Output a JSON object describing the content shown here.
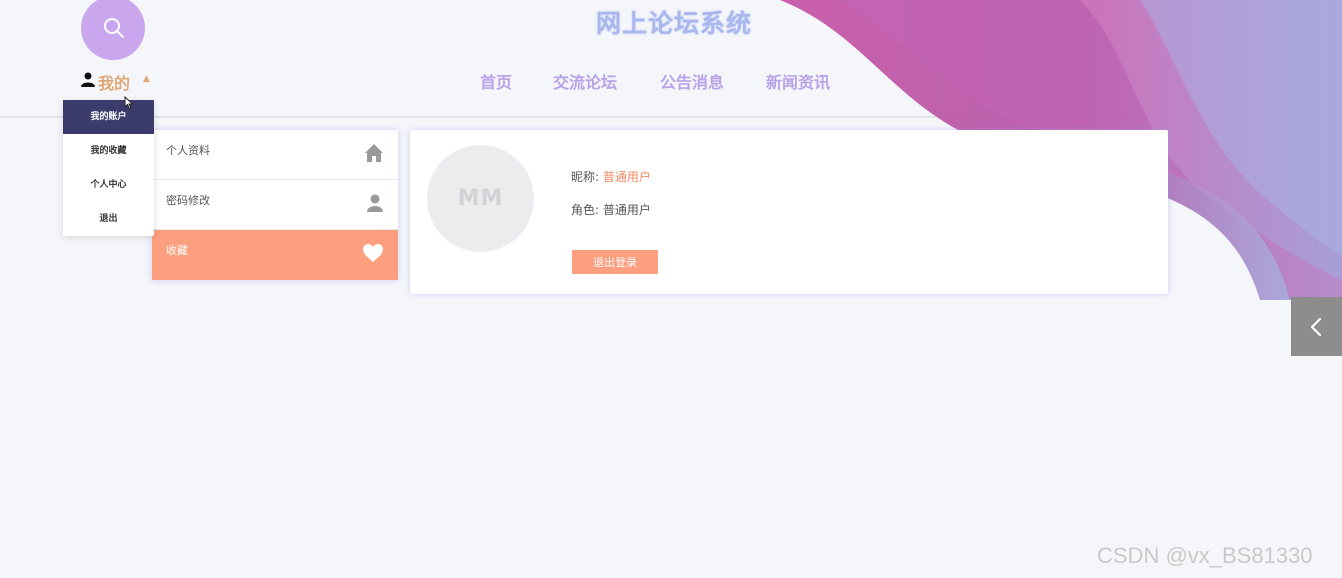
{
  "header": {
    "site_title": "网上论坛系统",
    "nav": [
      "首页",
      "交流论坛",
      "公告消息",
      "新闻资讯"
    ],
    "mine_label": "我的",
    "search_icon": "search-icon"
  },
  "dropdown": {
    "items": [
      "我的账户",
      "我的收藏",
      "个人中心",
      "退出"
    ],
    "active_index": 0
  },
  "side_menu": {
    "items": [
      {
        "label": "个人资料",
        "icon": "home-icon"
      },
      {
        "label": "密码修改",
        "icon": "user-icon"
      },
      {
        "label": "收藏",
        "icon": "heart-icon"
      }
    ],
    "active_index": 2
  },
  "profile": {
    "avatar_text": "MM",
    "nickname_label": "昵称: ",
    "nickname_value": "普通用户",
    "role_label": "角色: ",
    "role_value": "普通用户",
    "logout_label": "退出登录"
  },
  "watermark": "CSDN @vx_BS81330",
  "colors": {
    "accent": "#fc9f7e",
    "nav": "#b8a3e8",
    "title": "#a9b7ef",
    "active_dropdown": "#3b3c6c"
  }
}
